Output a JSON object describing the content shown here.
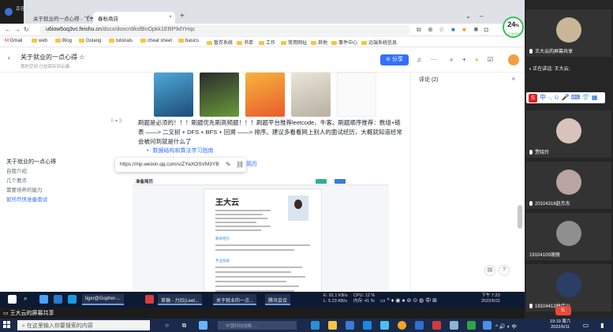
{
  "meeting": {
    "label": "正在共享",
    "share_caption": "王大云的屏幕共享",
    "speaking_now": "正在讲话: 王大云;"
  },
  "browser": {
    "tabs": [
      {
        "label": "关于就业的一点心得 - 飞书文档",
        "active": false
      },
      {
        "label": "春秋商店",
        "active": true
      }
    ],
    "url_host": "u6iow5oq3vc.feishu.cn",
    "url_path": "/docx/doxcn9ksfBnOpkk1ERP9dYHqc",
    "bookmarks": [
      "Gmail",
      "web",
      "Blog",
      "Golang",
      "tutorials",
      "cheat sheet",
      "basics",
      "暂存系统",
      "书单",
      "工作",
      "常用网址",
      "其他",
      "事件中心",
      "远端系统信息"
    ]
  },
  "doc": {
    "title": "关于就业的一点心得 ☆",
    "meta": "我的空间   已经保存到云端",
    "share_label": "分享",
    "outline": {
      "heading": "关于就业的一点心得",
      "items": [
        "自我介绍",
        "几个要点",
        "需要培养的能力",
        "如何尽快准备面试"
      ],
      "active_index": 3
    },
    "list_number": "⠿ ▾ 3.",
    "paragraph": "刷题是必须的！！！刷题优先刷高频题！！！刷题平台推荐leetcode、牛客。刷题顺序推荐：数组+链表 ——> 二叉树 + DFS + BFS + 回溯 ——> 排序。建议多看看网上别人的面试经历，大概就知道经常会被问到就是什么了",
    "bullet_link": "数据结构和算法学习指南",
    "link_popup_url": "https://mp.weixin.qq.com/s/ZYaXOSVM3YB",
    "trailing_link": "简历",
    "resume": {
      "toolbar_label": "准备简历",
      "name": "王大云",
      "section_1": "教育经历",
      "section_2": "专业技能"
    },
    "comments_title": "评论 (2)"
  },
  "screen_taskbar": {
    "items": [
      "tiger@Gopher-...",
      "草稿 - 力扣(Leet...",
      "关于就业的一点...",
      "腾讯会议"
    ],
    "net_up": "E: 91.1 KB/s",
    "net_down": "L: 5.23 KB/s",
    "cpu": "CPU: 12 %",
    "mem": "内存: 41 %",
    "time": "下午 7:20",
    "date": "2022/6/11"
  },
  "cpu_badge": {
    "value": "24",
    "unit": "%",
    "sub": "↓4.5KB/s"
  },
  "participants": [
    {
      "name": "王大云的屏幕共享",
      "avatar_color": "#c9b79a"
    },
    {
      "name": "",
      "avatar_color": "#5a6b7d"
    },
    {
      "name": "贾晓玲",
      "avatar_color": "#d8c3b8"
    },
    {
      "name": "20104316赵杰东",
      "avatar_color": "#b8a4a0"
    },
    {
      "name": "19104109谢丽",
      "avatar_color": "#8f8f8f"
    },
    {
      "name": "19104413林佳川",
      "avatar_color": "#2b3e66"
    }
  ],
  "ime": {
    "label": "中 ·, ☺ 🎤 ⌨ 👕 ▦"
  },
  "taskbar": {
    "search_placeholder": "在这里输入你要搜索的内容",
    "inner_search_placeholder": "中国科技战略 …",
    "tray": "^ 🔊 ◐ 中",
    "time": "19:19 周六",
    "date": "2022/6/11"
  },
  "colors": {
    "accent": "#3370ff",
    "taskbar": "#1b2a4a",
    "share_button": "#3370ff"
  }
}
